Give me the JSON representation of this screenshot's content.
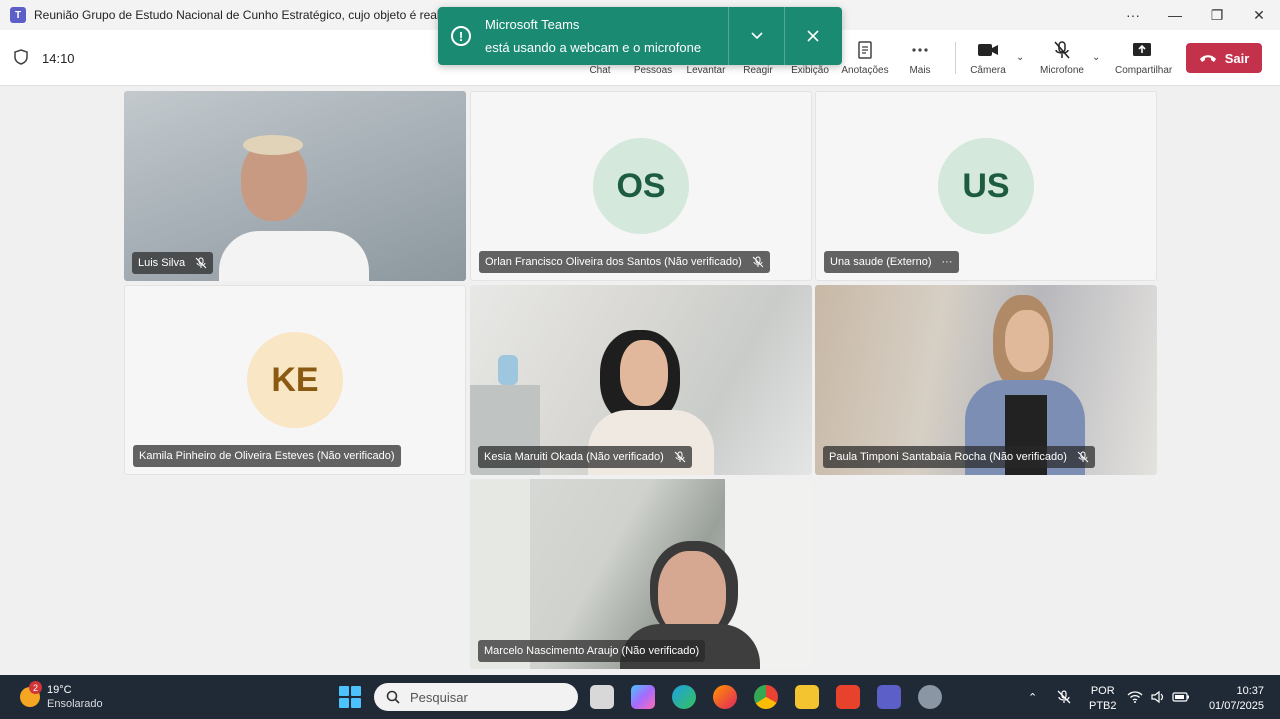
{
  "window": {
    "title": "Reunião Grupo de Estudo Nacional de Cunho Estratégico, cujo objeto é realizar estudos e elaborar propostas para a instit...",
    "app_icon": "teams-icon",
    "controls": {
      "more": "···",
      "minimize": "—",
      "maximize": "❐",
      "close": "✕"
    }
  },
  "meeting": {
    "timer": "14:10",
    "toolbar": {
      "chat": "Chat",
      "people": "Pessoas",
      "raise": "Levantar",
      "react": "Reagir",
      "view": "Exibição",
      "notes": "Anotações",
      "more": "Mais",
      "camera": "Câmera",
      "mic": "Microfone",
      "share": "Compartilhar",
      "leave": "Sair"
    }
  },
  "toast": {
    "title": "Microsoft Teams",
    "message": "está usando a webcam e o microfone",
    "bg_color": "#1a8a72"
  },
  "participants": [
    {
      "name": "Luis Silva",
      "type": "video",
      "muted": true
    },
    {
      "name": "Orlan Francisco Oliveira dos Santos (Não verificado)",
      "initials": "OS",
      "type": "avatar",
      "muted": true,
      "avatar_color": "#d4e8dc",
      "text_color": "#1d5c3f"
    },
    {
      "name": "Una saude (Externo)",
      "initials": "US",
      "type": "avatar",
      "more": "···",
      "avatar_color": "#d4e8dc",
      "text_color": "#1d5c3f"
    },
    {
      "name": "Kamila Pinheiro de Oliveira Esteves (Não verificado)",
      "initials": "KE",
      "type": "avatar",
      "avatar_color": "#f8e6c4",
      "text_color": "#8a5a12"
    },
    {
      "name": "Kesia Maruiti Okada (Não verificado)",
      "type": "video",
      "muted": true
    },
    {
      "name": "Paula Timponi Santabaia Rocha (Não verificado)",
      "type": "video",
      "muted": true
    },
    {
      "name": "Marcelo Nascimento Araujo (Não verificado)",
      "type": "video",
      "muted": false
    }
  ],
  "taskbar": {
    "weather": {
      "temp": "19°C",
      "condition": "Ensolarado",
      "badge": "2"
    },
    "search_placeholder": "Pesquisar",
    "lang": {
      "line1": "POR",
      "line2": "PTB2"
    },
    "time": "10:37",
    "date": "01/07/2025"
  }
}
